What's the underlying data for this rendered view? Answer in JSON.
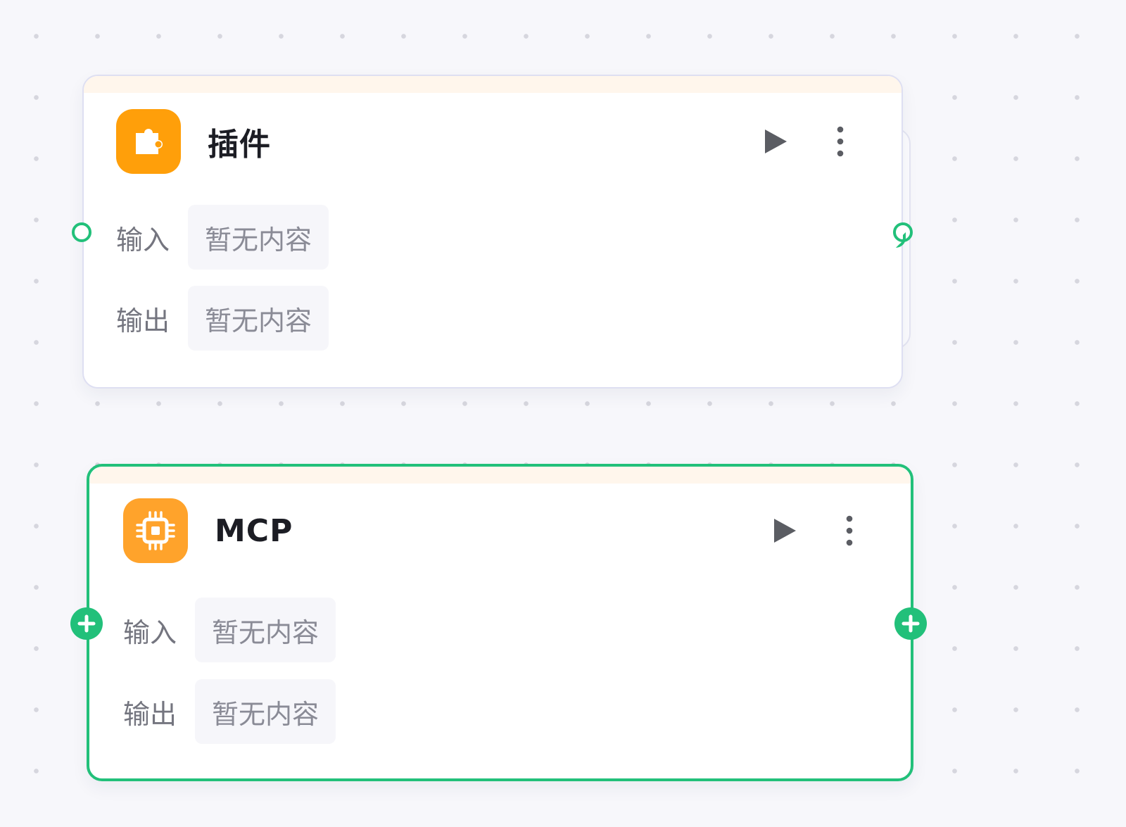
{
  "canvas": {
    "background": "#f7f7fb",
    "dot_color": "#d6d6de"
  },
  "colors": {
    "accent_green": "#22c07a",
    "plugin_icon_bg": "#ff9f0a",
    "mcp_icon_bg": "#ffa32b",
    "header_strip": "#fff6ec"
  },
  "nodes": [
    {
      "title": "插件",
      "icon": "puzzle-piece-icon",
      "selected": false,
      "actions": {
        "run_icon": "play-icon",
        "menu_icon": "more-vertical-icon"
      },
      "input_label": "输入",
      "input_value": "暂无内容",
      "output_label": "输出",
      "output_value": "暂无内容",
      "input_port": "hollow-port",
      "output_port": "hollow-port"
    },
    {
      "title": "MCP",
      "icon": "cpu-chip-icon",
      "selected": true,
      "actions": {
        "run_icon": "play-icon",
        "menu_icon": "more-vertical-icon"
      },
      "input_label": "输入",
      "input_value": "暂无内容",
      "output_label": "输出",
      "output_value": "暂无内容",
      "input_port": "add-port",
      "output_port": "add-port"
    }
  ]
}
